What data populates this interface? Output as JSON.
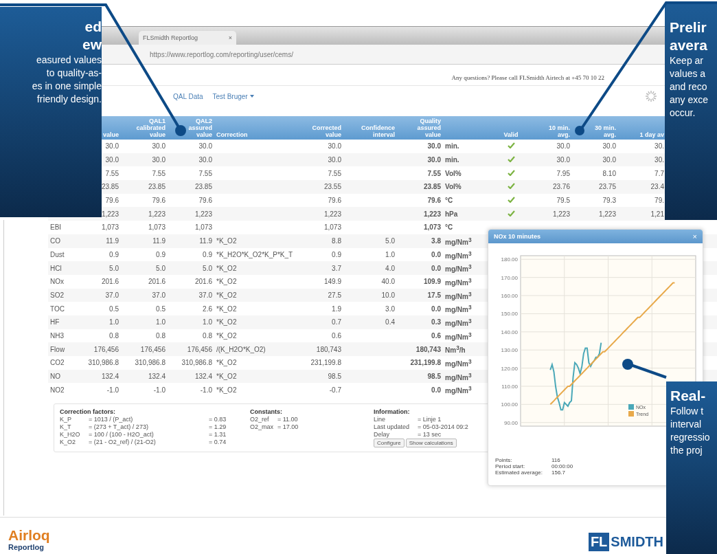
{
  "browser": {
    "tab": {
      "title": "FLSmidth Reportlog",
      "close": "×"
    },
    "url": "https://www.reportlog.com/reporting/user/cems/"
  },
  "support_text": "Any questions? Please call FLSmidth Airtech at +45 70 10 22",
  "nav": [
    {
      "label": "QAL Data",
      "dropdown": false
    },
    {
      "label": "Test Bruger",
      "dropdown": true
    }
  ],
  "table": {
    "columns": [
      "value",
      "QAL1 calibrated value",
      "QAL2 assured value",
      "Correction",
      "Corrected value",
      "Confidence interval",
      "Quality assured value",
      "",
      "Valid",
      "10 min. avg.",
      "30 min. avg.",
      "1 day av"
    ],
    "rows": [
      {
        "value": "30.0",
        "qal1": "30.0",
        "qal2": "30.0",
        "correction": "",
        "corrected": "30.0",
        "confidence": "",
        "qa": "30.0",
        "unit": "min.",
        "valid": true,
        "avg10": "30.0",
        "avg30": "30.0",
        "day": "30."
      },
      {
        "value": "30.0",
        "qal1": "30.0",
        "qal2": "30.0",
        "correction": "",
        "corrected": "30.0",
        "confidence": "",
        "qa": "30.0",
        "unit": "min.",
        "valid": true,
        "avg10": "30.0",
        "avg30": "30.0",
        "day": "30."
      },
      {
        "value": "7.55",
        "qal1": "7.55",
        "qal2": "7.55",
        "correction": "",
        "corrected": "7.55",
        "confidence": "",
        "qa": "7.55",
        "unit": "Vol%",
        "valid": true,
        "avg10": "7.95",
        "avg30": "8.10",
        "day": "7.7"
      },
      {
        "value": "23.85",
        "qal1": "23.85",
        "qal2": "23.85",
        "correction": "",
        "corrected": "23.55",
        "confidence": "",
        "qa": "23.85",
        "unit": "Vol%",
        "valid": true,
        "avg10": "23.76",
        "avg30": "23.75",
        "day": "23.4"
      },
      {
        "value": "79.6",
        "qal1": "79.6",
        "qal2": "79.6",
        "correction": "",
        "corrected": "79.6",
        "confidence": "",
        "qa": "79.6",
        "unit": "°C",
        "valid": true,
        "avg10": "79.5",
        "avg30": "79.3",
        "day": "79."
      },
      {
        "value": "1,223",
        "qal1": "1,223",
        "qal2": "1,223",
        "correction": "",
        "corrected": "1,223",
        "confidence": "",
        "qa": "1,223",
        "unit": "hPa",
        "valid": true,
        "avg10": "1,223",
        "avg30": "1,223",
        "day": "1,21"
      },
      {
        "name": "EBI",
        "value": "1,073",
        "qal1": "1,073",
        "qal2": "1,073",
        "correction": "",
        "corrected": "1,073",
        "confidence": "",
        "qa": "1,073",
        "unit": "°C"
      },
      {
        "name": "CO",
        "value": "11.9",
        "qal1": "11.9",
        "qal2": "11.9",
        "correction": "*K_O2",
        "corrected": "8.8",
        "confidence": "5.0",
        "qa": "3.8",
        "unit": "mg/Nm$^{3}$"
      },
      {
        "name": "Dust",
        "value": "0.9",
        "qal1": "0.9",
        "qal2": "0.9",
        "correction": "*K_H2O*K_O2*K_P*K_T",
        "corrected": "0.9",
        "confidence": "1.0",
        "qa": "0.0",
        "unit": "mg/Nm$^{3}$"
      },
      {
        "name": "HCl",
        "value": "5.0",
        "qal1": "5.0",
        "qal2": "5.0",
        "correction": "*K_O2",
        "corrected": "3.7",
        "confidence": "4.0",
        "qa": "0.0",
        "unit": "mg/Nm$^{3}$"
      },
      {
        "name": "NOx",
        "value": "201.6",
        "qal1": "201.6",
        "qal2": "201.6",
        "correction": "*K_O2",
        "corrected": "149.9",
        "confidence": "40.0",
        "qa": "109.9",
        "unit": "mg/Nm$^{3}$"
      },
      {
        "name": "SO2",
        "value": "37.0",
        "qal1": "37.0",
        "qal2": "37.0",
        "correction": "*K_O2",
        "corrected": "27.5",
        "confidence": "10.0",
        "qa": "17.5",
        "unit": "mg/Nm$^{3}$"
      },
      {
        "name": "TOC",
        "value": "0.5",
        "qal1": "0.5",
        "qal2": "2.6",
        "correction": "*K_O2",
        "corrected": "1.9",
        "confidence": "3.0",
        "qa": "0.0",
        "unit": "mg/Nm$^{3}$"
      },
      {
        "name": "HF",
        "value": "1.0",
        "qal1": "1.0",
        "qal2": "1.0",
        "correction": "*K_O2",
        "corrected": "0.7",
        "confidence": "0.4",
        "qa": "0.3",
        "unit": "mg/Nm$^{3}$"
      },
      {
        "name": "NH3",
        "value": "0.8",
        "qal1": "0.8",
        "qal2": "0.8",
        "correction": "*K_O2",
        "corrected": "0.6",
        "confidence": "",
        "qa": "0.6",
        "unit": "mg/Nm$^{3}$"
      },
      {
        "name": "Flow",
        "value": "176,456",
        "qal1": "176,456",
        "qal2": "176,456",
        "correction": "/(K_H2O*K_O2)",
        "corrected": "180,743",
        "confidence": "",
        "qa": "180,743",
        "unit": "Nm$^{3}$/h"
      },
      {
        "name": "CO2",
        "value": "310,986.8",
        "qal1": "310,986.8",
        "qal2": "310,986.8",
        "correction": "*K_O2",
        "corrected": "231,199.8",
        "confidence": "",
        "qa": "231,199.8",
        "unit": "mg/Nm$^{3}$"
      },
      {
        "name": "NO",
        "value": "132.4",
        "qal1": "132.4",
        "qal2": "132.4",
        "correction": "*K_O2",
        "corrected": "98.5",
        "confidence": "",
        "qa": "98.5",
        "unit": "mg/Nm$^{3}$"
      },
      {
        "name": "NO2",
        "value": "-1.0",
        "qal1": "-1.0",
        "qal2": "-1.0",
        "correction": "*K_O2",
        "corrected": "-0.7",
        "confidence": "",
        "qa": "0.0",
        "unit": "mg/Nm$^{3}$"
      }
    ]
  },
  "details": {
    "correction_factors": {
      "title": "Correction factors:",
      "rows": [
        [
          "K_P",
          "= 1013 / (P_act)",
          "= 0.83"
        ],
        [
          "K_T",
          "= (273 + T_act) / 273)",
          "= 1.29"
        ],
        [
          "K_H2O",
          "= 100 / (100 - H2O_act)",
          "= 1.31"
        ],
        [
          "K_O2",
          "= (21 - O2_ref) / (21-O2)",
          "= 0.74"
        ]
      ]
    },
    "constants": {
      "title": "Constants:",
      "rows": [
        [
          "O2_ref",
          "= 11.00"
        ],
        [
          "O2_max",
          "= 17.00"
        ]
      ]
    },
    "information": {
      "title": "Information:",
      "rows": [
        [
          "Line",
          "= Linje 1"
        ],
        [
          "Last updated",
          "= 05-03-2014 09:2"
        ],
        [
          "Delay",
          "= 13 sec"
        ]
      ],
      "buttons": [
        "Configure",
        "Show calculations"
      ]
    }
  },
  "chart_popup": {
    "title": "NOx 10 minutes",
    "close": "×",
    "chart_data": {
      "type": "line",
      "categories": [
        null,
        null,
        null,
        null,
        null,
        null,
        null,
        null,
        null,
        null,
        null,
        null,
        null,
        null,
        null,
        null,
        null,
        null,
        null,
        null,
        null,
        null,
        null,
        null,
        null,
        null,
        null,
        null,
        null,
        null,
        null,
        null,
        null,
        null,
        null,
        null,
        null,
        null,
        null,
        null,
        null,
        null,
        null,
        null,
        null,
        null,
        null,
        null,
        null,
        null,
        null,
        null,
        null,
        null,
        null,
        null,
        null,
        null,
        null,
        null,
        null,
        null,
        null,
        null,
        null,
        null,
        null,
        null,
        null,
        null,
        null,
        null
      ],
      "ylim": [
        88,
        182
      ],
      "grid": true,
      "legend": "bottom-right",
      "yticks": [
        {
          "value": 90,
          "label": "90.00"
        },
        {
          "value": 100,
          "label": "100.00"
        },
        {
          "value": 110,
          "label": "110.00"
        },
        {
          "value": 120,
          "label": "120.00"
        },
        {
          "value": 130,
          "label": "130.00"
        },
        {
          "value": 140,
          "label": "140.00"
        },
        {
          "value": 150,
          "label": "150.00"
        },
        {
          "value": 160,
          "label": "160.00"
        },
        {
          "value": 170,
          "label": "170.00"
        },
        {
          "value": 180,
          "label": "180.00"
        }
      ],
      "series": [
        {
          "name": "NOx",
          "color": "#4aa8b8",
          "values": [
            119,
            122,
            118,
            110,
            104,
            101,
            97,
            97,
            101,
            100,
            99,
            101,
            102,
            115,
            123,
            122,
            120,
            117,
            121,
            128,
            131,
            131,
            123,
            121,
            123,
            124,
            126,
            126,
            128,
            134,
            null,
            null,
            null,
            null,
            null,
            null,
            null,
            null,
            null,
            null,
            null,
            null,
            null,
            null,
            null,
            null,
            null,
            null,
            null,
            null,
            null,
            null,
            null,
            null,
            null,
            null,
            null,
            null,
            null,
            null,
            null,
            null,
            null,
            null,
            null,
            null,
            null,
            null,
            null,
            null,
            null,
            null
          ]
        },
        {
          "name": "Trend",
          "color": "#e8a94a",
          "values": [
            100,
            101,
            102,
            103,
            104,
            105,
            106,
            107,
            108,
            109,
            110,
            110,
            111,
            112,
            113,
            114,
            115,
            116,
            117,
            118,
            119,
            120,
            121,
            122,
            123,
            124,
            125,
            126,
            127,
            128,
            129,
            129,
            130,
            131,
            132,
            133,
            134,
            135,
            136,
            137,
            138,
            139,
            140,
            141,
            142,
            143,
            144,
            145,
            146,
            147,
            148,
            148,
            149,
            150,
            151,
            152,
            153,
            154,
            155,
            156,
            157,
            158,
            159,
            160,
            161,
            162,
            163,
            164,
            165,
            166,
            167,
            167
          ]
        }
      ]
    },
    "stats": [
      [
        "Points:",
        "116"
      ],
      [
        "Period start:",
        "00:00:00"
      ],
      [
        "Estimated average:",
        "156.7"
      ]
    ]
  },
  "brand": {
    "product": "Airloq",
    "subtitle": "Reportlog",
    "logo_mark": "FL",
    "logo_text": "SMIDTH"
  },
  "callouts": [
    {
      "kind": "left",
      "title": [
        "ed",
        "ew"
      ],
      "body": [
        "easured values",
        "to quality-as-",
        "es in one simple",
        "friendly design."
      ]
    },
    {
      "kind": "right",
      "title": [
        "Prelir",
        "avera"
      ],
      "body": [
        "Keep ar",
        "values a",
        "and reco",
        "any exce",
        "occur."
      ]
    },
    {
      "kind": "bottom",
      "title": [
        "Real-"
      ],
      "body": [
        "Follow t",
        "interval",
        "regressio",
        "the proj"
      ]
    }
  ]
}
